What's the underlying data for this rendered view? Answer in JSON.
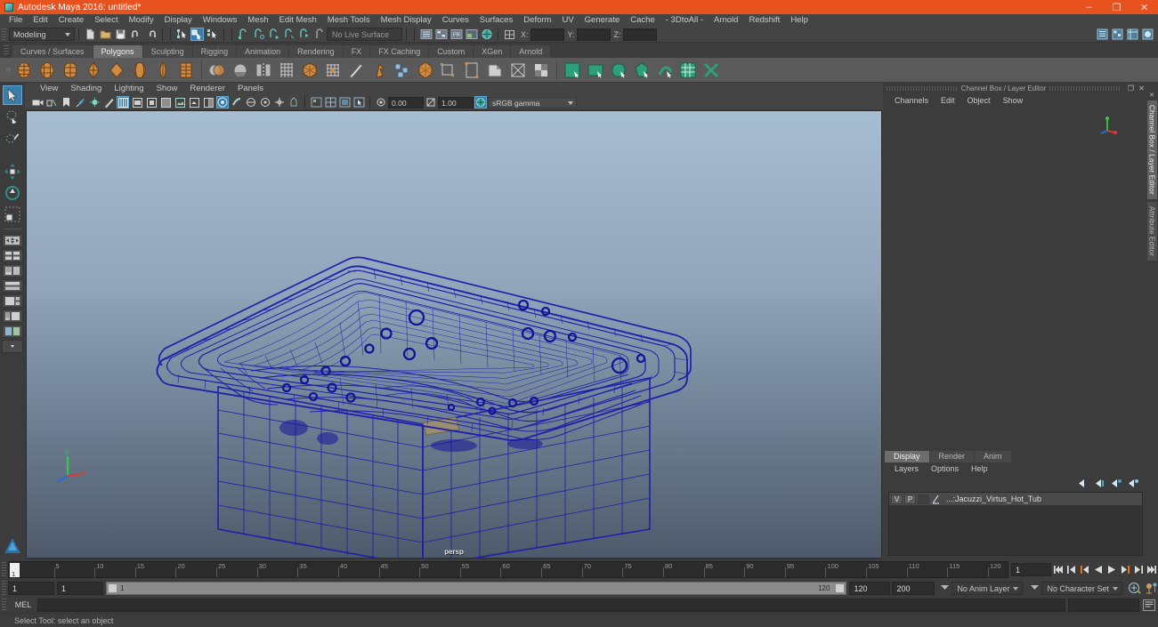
{
  "window": {
    "title": "Autodesk Maya 2016: untitled*",
    "app_icon": "maya-logo-icon",
    "minimize": "–",
    "maximize": "❐",
    "close": "✕",
    "accent": "#e8521f"
  },
  "menubar": {
    "items": [
      "File",
      "Edit",
      "Create",
      "Select",
      "Modify",
      "Display",
      "Windows",
      "Mesh",
      "Edit Mesh",
      "Mesh Tools",
      "Mesh Display",
      "Curves",
      "Surfaces",
      "Deform",
      "UV",
      "Generate",
      "Cache",
      "- 3DtoAll -",
      "Arnold",
      "Redshift",
      "Help"
    ]
  },
  "statusline": {
    "mode": "Modeling",
    "live_surface": "No Live Surface",
    "coord_x_label": "X:",
    "coord_y_label": "Y:",
    "coord_z_label": "Z:",
    "coord_x_value": "",
    "coord_y_value": "",
    "coord_z_value": "",
    "icons": [
      "new-scene-icon",
      "open-scene-icon",
      "save-scene-icon",
      "undo-icon",
      "redo-icon",
      "select-hierarchy-icon",
      "select-object-icon",
      "select-component-icon",
      "snap-to-grid-icon",
      "snap-to-curve-icon",
      "snap-to-point-icon",
      "snap-to-projected-center-icon",
      "snap-to-view-plane-icon",
      "make-live-icon",
      "show-outliner-icon",
      "show-hypergraph-icon",
      "show-hypershade-icon",
      "show-render-view-icon",
      "render-icon"
    ],
    "right_icons": [
      "sidebar-attribute-icon",
      "sidebar-tool-icon",
      "sidebar-channel-icon",
      "sidebar-layer-icon"
    ]
  },
  "shelf": {
    "tabs": [
      "Curves / Surfaces",
      "Polygons",
      "Sculpting",
      "Rigging",
      "Animation",
      "Rendering",
      "FX",
      "FX Caching",
      "Custom",
      "XGen",
      "Arnold"
    ],
    "active_tab": "Polygons",
    "orange_icons": [
      "poly-sphere-icon",
      "poly-cube-icon",
      "poly-cylinder-icon",
      "poly-cone-icon",
      "poly-torus-icon",
      "poly-plane-icon",
      "poly-disc-icon",
      "poly-platonic-icon"
    ],
    "gray_icons": [
      "combine-icon",
      "separate-icon",
      "mirror-icon",
      "bridge-icon",
      "smooth-icon",
      "extrude-icon",
      "multi-cut-icon",
      "target-weld-icon",
      "quad-draw-icon",
      "bevel-icon",
      "boolean-icon",
      "bool-difference-icon",
      "bool-union-icon",
      "bool-intersect-icon",
      "crease-icon"
    ],
    "green_icons": [
      "uv-editor-icon",
      "uv-planar-icon",
      "uv-cylindrical-icon",
      "uv-spherical-icon",
      "uv-automatic-icon",
      "uv-layout-icon",
      "uv-unfold-icon"
    ]
  },
  "toolbox": {
    "tools": [
      {
        "name": "select-tool",
        "active": true
      },
      {
        "name": "lasso-select-tool",
        "active": false
      },
      {
        "name": "paint-select-tool",
        "active": false
      },
      {
        "name": "move-tool",
        "active": false
      },
      {
        "name": "rotate-tool",
        "active": false
      },
      {
        "name": "scale-tool",
        "active": false
      }
    ],
    "layouts": [
      "layout-single-pane",
      "layout-four-pane",
      "layout-two-pane-side",
      "layout-two-pane-stacked",
      "layout-three-pane-right",
      "layout-persp-outliner",
      "layout-persp-graph",
      "layout-more"
    ],
    "logo": "maya-logo-icon"
  },
  "viewport": {
    "menus": [
      "View",
      "Shading",
      "Lighting",
      "Show",
      "Renderer",
      "Panels"
    ],
    "label": "persp",
    "exposure_value": "0.00",
    "gamma_value": "1.00",
    "color_management": "sRGB gamma",
    "bg_top": "#a7bdd2",
    "bg_bottom": "#4e5a6b",
    "wire_color": "#1c1ca0",
    "icons": [
      "camera-attributes-icon",
      "two-sided-lighting-icon",
      "bookmark-icon",
      "image-plane-icon",
      "light-icon",
      "grease-pencil-icon",
      "wireframe-icon",
      "smooth-shade-all-icon",
      "shaded-wireframe-icon",
      "flat-shade-icon",
      "textured-icon",
      "use-all-lights-icon",
      "shadows-icon",
      "screen-space-ao-icon",
      "motion-blur-icon",
      "multisample-icon",
      "depth-of-field-icon",
      "isolate-select-icon",
      "xray-icon",
      "xray-joints-icon",
      "exposure-icon",
      "gamma-icon",
      "color-management-icon"
    ]
  },
  "channelbox": {
    "panel_title": "Channel Box / Layer Editor",
    "float_button": "❐",
    "close_button": "✕",
    "menus": [
      "Channels",
      "Edit",
      "Object",
      "Show"
    ],
    "gizmo": "axis-gizmo-icon"
  },
  "layereditor": {
    "tabs": [
      "Display",
      "Render",
      "Anim"
    ],
    "active_tab": "Display",
    "menus": [
      "Layers",
      "Options",
      "Help"
    ],
    "tools": [
      "layer-first-icon",
      "layer-prev-icon",
      "layer-next-icon",
      "layer-last-icon"
    ],
    "layers": [
      {
        "visibility": "V",
        "playback": "P",
        "type": "",
        "color": "#9aa0d8",
        "name": "...:Jacuzzi_Virtus_Hot_Tub"
      }
    ]
  },
  "sidetabs": {
    "close": "✕",
    "tabs": [
      "Channel Box / Layer Editor",
      "Attribute Editor"
    ],
    "active": "Channel Box / Layer Editor"
  },
  "timeline": {
    "current_frame": "1",
    "ticks": [
      5,
      10,
      15,
      20,
      25,
      30,
      35,
      40,
      45,
      50,
      55,
      60,
      65,
      70,
      75,
      80,
      85,
      90,
      95,
      100,
      105,
      110,
      115,
      120
    ],
    "start": 1,
    "end": 120,
    "playback_buttons": [
      "go-to-start-icon",
      "step-back-frame-icon",
      "step-back-key-icon",
      "play-backwards-icon",
      "play-forwards-icon",
      "step-forward-key-icon",
      "step-forward-frame-icon",
      "go-to-end-icon"
    ]
  },
  "rangeslider": {
    "anim_start": "1",
    "range_start": "1",
    "bar_start_label": "1",
    "bar_end_label": "120",
    "range_end": "120",
    "anim_end": "200",
    "anim_layer": "No Anim Layer",
    "character_set": "No Character Set",
    "icons": [
      "auto-key-icon",
      "animation-preferences-icon"
    ]
  },
  "commandline": {
    "language": "MEL",
    "input_value": "",
    "output_value": "",
    "script_editor_icon": "script-editor-icon"
  },
  "helpline": {
    "text": "Select Tool: select an object"
  }
}
